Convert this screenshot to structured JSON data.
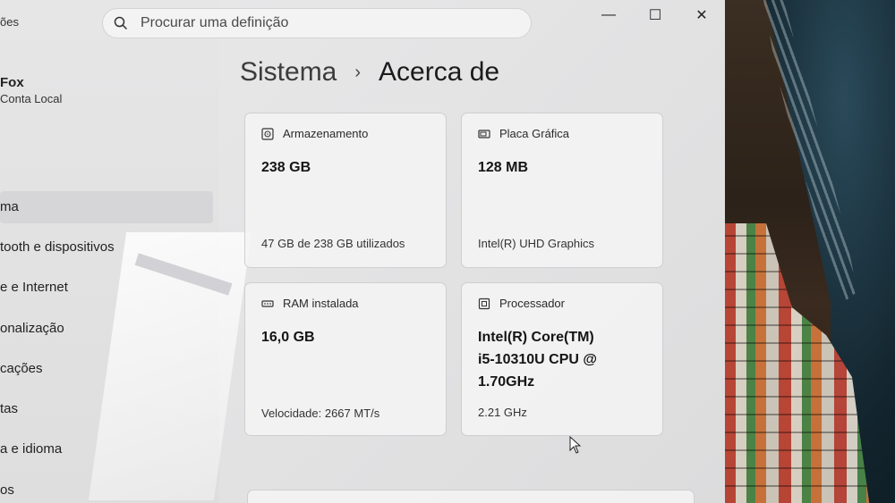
{
  "window": {
    "controls": {
      "minimize": "—",
      "maximize": "☐",
      "close": "✕"
    }
  },
  "search": {
    "placeholder": "Procurar uma definição",
    "left_edge_text": "ões"
  },
  "user": {
    "name": "Fox",
    "account_type": "Conta Local"
  },
  "sidebar": {
    "items": [
      {
        "label": "ma",
        "active": true
      },
      {
        "label": "tooth e dispositivos",
        "active": false
      },
      {
        "label": "e e Internet",
        "active": false
      },
      {
        "label": "onalização",
        "active": false
      },
      {
        "label": "cações",
        "active": false
      },
      {
        "label": "tas",
        "active": false
      },
      {
        "label": "a e idioma",
        "active": false
      },
      {
        "label": "os",
        "active": false
      }
    ]
  },
  "breadcrumb": {
    "parent": "Sistema",
    "separator": "›",
    "current": "Acerca de"
  },
  "cards": {
    "storage": {
      "title": "Armazenamento",
      "value": "238 GB",
      "detail": "47 GB de 238 GB utilizados",
      "icon": "storage-icon"
    },
    "gpu": {
      "title": "Placa Gráfica",
      "value": "128 MB",
      "detail": "Intel(R) UHD Graphics",
      "icon": "gpu-icon"
    },
    "ram": {
      "title": "RAM instalada",
      "value": "16,0 GB",
      "detail": "Velocidade: 2667 MT/s",
      "icon": "ram-icon"
    },
    "cpu": {
      "title": "Processador",
      "value_line1": "Intel(R) Core(TM)",
      "value_line2": "i5-10310U CPU @",
      "value_line3": "1.70GHz",
      "detail": "2.21 GHz",
      "icon": "cpu-icon"
    }
  }
}
